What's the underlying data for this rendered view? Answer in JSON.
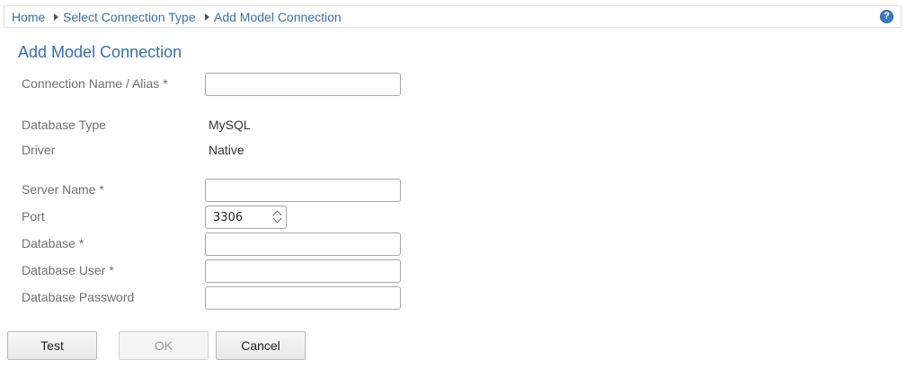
{
  "breadcrumb": {
    "items": [
      "Home",
      "Select Connection Type",
      "Add Model Connection"
    ]
  },
  "help": {
    "symbol": "?"
  },
  "page_title": "Add Model Connection",
  "form": {
    "connection_name": {
      "label": "Connection Name / Alias *",
      "value": ""
    },
    "database_type": {
      "label": "Database Type",
      "value": "MySQL"
    },
    "driver": {
      "label": "Driver",
      "value": "Native"
    },
    "server_name": {
      "label": "Server Name *",
      "value": ""
    },
    "port": {
      "label": "Port",
      "value": "3306"
    },
    "database": {
      "label": "Database *",
      "value": ""
    },
    "database_user": {
      "label": "Database User *",
      "value": ""
    },
    "database_password": {
      "label": "Database Password",
      "value": ""
    }
  },
  "buttons": {
    "test": "Test",
    "ok": "OK",
    "cancel": "Cancel"
  },
  "colors": {
    "link": "#3a6fa8",
    "label": "#707070",
    "help": "#3a7bc8"
  }
}
